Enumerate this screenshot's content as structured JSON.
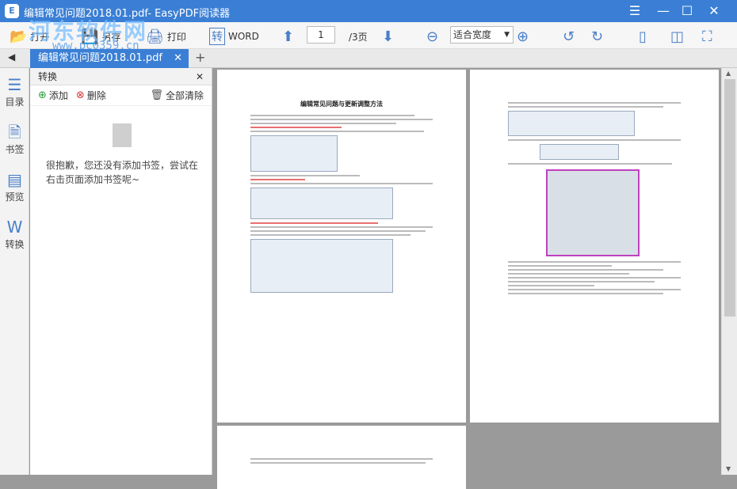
{
  "window": {
    "title": "编辑常见问题2018.01.pdf- EasyPDF阅读器",
    "logo_letter": "E"
  },
  "watermark": {
    "text": "河东软件网",
    "url": "www.pc0359.cn"
  },
  "controls": {
    "minimize": "—",
    "restore": "▢",
    "maximize": "☐",
    "close": "✕",
    "menu": "☰"
  },
  "toolbar": {
    "open": "打开",
    "save": "另存",
    "print": "打印",
    "word": "WORD",
    "page_current": "1",
    "page_total": "/3页",
    "zoom": "适合宽度"
  },
  "tab": {
    "name": "编辑常见问题2018.01.pdf",
    "close": "✕",
    "add": "+"
  },
  "rail": {
    "toggle": "◀",
    "items": [
      {
        "label": "目录",
        "icon": "outline-icon"
      },
      {
        "label": "书签",
        "icon": "bookmark-icon"
      },
      {
        "label": "预览",
        "icon": "preview-icon"
      },
      {
        "label": "转换",
        "icon": "convert-icon"
      }
    ]
  },
  "panel": {
    "title": "转换",
    "close": "✕",
    "add": "添加",
    "delete": "删除",
    "clear_all": "全部清除",
    "empty_text": "很抱歉，您还没有添加书签，尝试在右击页面添加书签呢~"
  },
  "doc": {
    "page1_title": "编辑常见问题与更新调整方法"
  },
  "colors": {
    "accent": "#3a7fd5"
  }
}
